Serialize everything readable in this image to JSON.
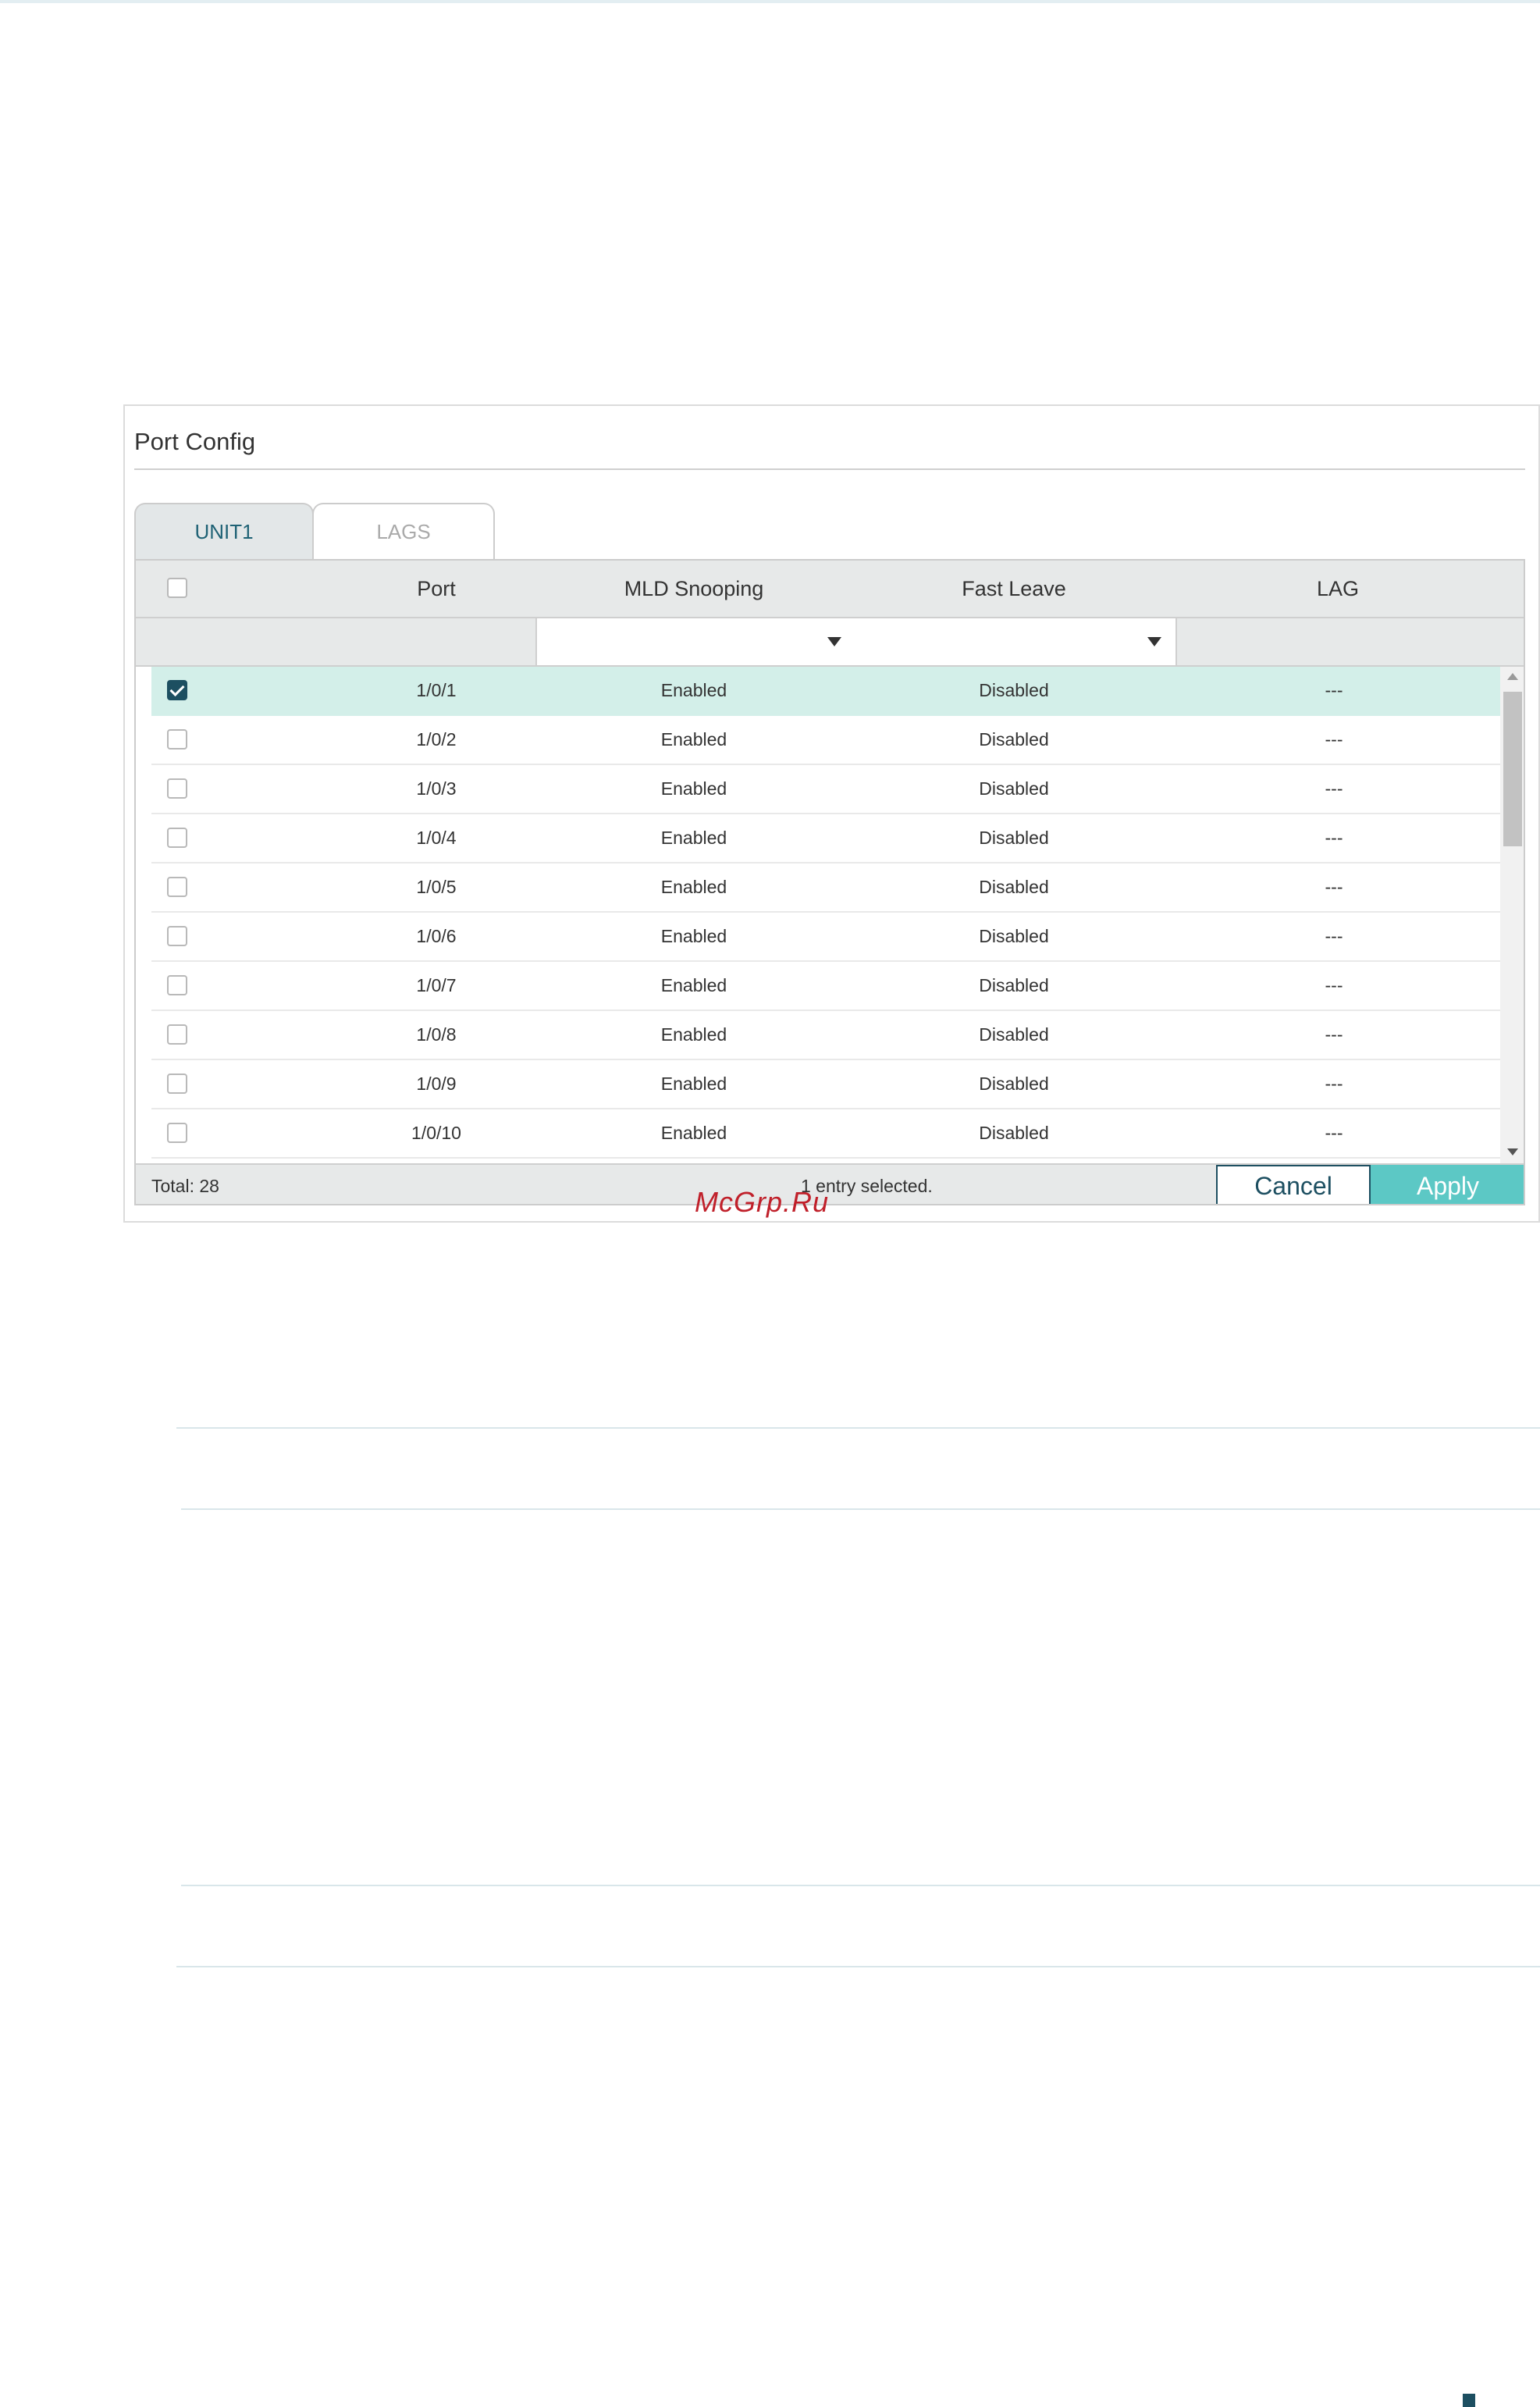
{
  "watermark": "McGrp.Ru",
  "panel": {
    "title": "Port Config",
    "tabs": [
      {
        "label": "UNIT1",
        "active": true
      },
      {
        "label": "LAGS",
        "active": false
      }
    ],
    "table": {
      "columns": [
        "Port",
        "MLD Snooping",
        "Fast Leave",
        "LAG"
      ],
      "filters": {
        "mld_snooping": "",
        "fast_leave": ""
      },
      "rows": [
        {
          "port": "1/0/1",
          "mld_snooping": "Enabled",
          "fast_leave": "Disabled",
          "lag": "---",
          "checked": true
        },
        {
          "port": "1/0/2",
          "mld_snooping": "Enabled",
          "fast_leave": "Disabled",
          "lag": "---",
          "checked": false
        },
        {
          "port": "1/0/3",
          "mld_snooping": "Enabled",
          "fast_leave": "Disabled",
          "lag": "---",
          "checked": false
        },
        {
          "port": "1/0/4",
          "mld_snooping": "Enabled",
          "fast_leave": "Disabled",
          "lag": "---",
          "checked": false
        },
        {
          "port": "1/0/5",
          "mld_snooping": "Enabled",
          "fast_leave": "Disabled",
          "lag": "---",
          "checked": false
        },
        {
          "port": "1/0/6",
          "mld_snooping": "Enabled",
          "fast_leave": "Disabled",
          "lag": "---",
          "checked": false
        },
        {
          "port": "1/0/7",
          "mld_snooping": "Enabled",
          "fast_leave": "Disabled",
          "lag": "---",
          "checked": false
        },
        {
          "port": "1/0/8",
          "mld_snooping": "Enabled",
          "fast_leave": "Disabled",
          "lag": "---",
          "checked": false
        },
        {
          "port": "1/0/9",
          "mld_snooping": "Enabled",
          "fast_leave": "Disabled",
          "lag": "---",
          "checked": false
        },
        {
          "port": "1/0/10",
          "mld_snooping": "Enabled",
          "fast_leave": "Disabled",
          "lag": "---",
          "checked": false
        }
      ]
    },
    "footer": {
      "total": "Total: 28",
      "selected": "1 entry selected.",
      "cancel_label": "Cancel",
      "apply_label": "Apply"
    }
  },
  "colors": {
    "accent": "#5cc8c5",
    "dark_teal": "#1d4f61",
    "selected_row": "#d3efe9",
    "header_bg": "#e7e9e9"
  }
}
